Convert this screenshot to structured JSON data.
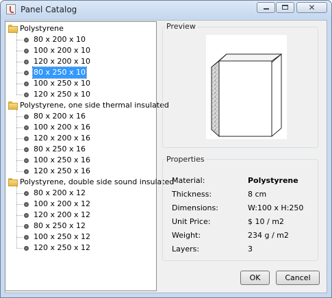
{
  "window": {
    "title": "Panel Catalog",
    "close_glyph": "✕"
  },
  "tree": {
    "groups": [
      {
        "label": "Polystyrene",
        "items": [
          "80 x 200 x 10",
          "100 x 200 x 10",
          "120 x 200 x 10",
          "80 x 250 x 10",
          "100 x 250 x 10",
          "120 x 250 x 10"
        ]
      },
      {
        "label": "Polystyrene, one side thermal insulated",
        "items": [
          "80 x 200 x 16",
          "100 x 200 x 16",
          "120 x 200 x 16",
          "80 x 250 x 16",
          "100 x 250 x 16",
          "120 x 250 x 16"
        ]
      },
      {
        "label": "Polystyrene, double side sound insulated",
        "items": [
          "80 x 200 x 12",
          "100 x 200 x 12",
          "120 x 200 x 12",
          "80 x 250 x 12",
          "100 x 250 x 12",
          "120 x 250 x 12"
        ]
      }
    ],
    "selected": "80 x 250 x 10"
  },
  "preview": {
    "title": "Preview"
  },
  "properties": {
    "title": "Properties",
    "rows": [
      {
        "label": "Material:",
        "value": "Polystyrene",
        "bold": true
      },
      {
        "label": "Thickness:",
        "value": "8 cm"
      },
      {
        "label": "Dimensions:",
        "value": "W:100 x H:250"
      },
      {
        "label": "Unit Price:",
        "value": "$ 10 / m2"
      },
      {
        "label": "Weight:",
        "value": "234 g / m2"
      },
      {
        "label": "Layers:",
        "value": "3"
      }
    ]
  },
  "buttons": {
    "ok": "OK",
    "cancel": "Cancel"
  }
}
